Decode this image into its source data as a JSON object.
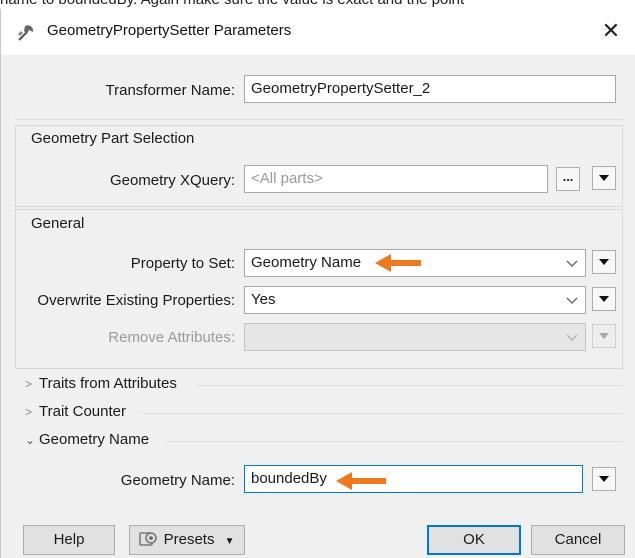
{
  "background_text": "name to boundedBy. Again make sure the value is exact and the point",
  "window": {
    "title": "GeometryPropertySetter Parameters"
  },
  "transformer": {
    "label": "Transformer Name:",
    "value": "GeometryPropertySetter_2"
  },
  "part_selection": {
    "group_title": "Geometry Part Selection",
    "xquery_label": "Geometry XQuery:",
    "xquery_placeholder": "<All parts>",
    "ellipsis_label": "..."
  },
  "general": {
    "group_title": "General",
    "property_label": "Property to Set:",
    "property_value": "Geometry Name",
    "overwrite_label": "Overwrite Existing Properties:",
    "overwrite_value": "Yes",
    "remove_label": "Remove Attributes:",
    "remove_value": ""
  },
  "sections": {
    "traits_attributes": "Traits from Attributes",
    "trait_counter": "Trait Counter",
    "geometry_name": "Geometry Name"
  },
  "geometry_name": {
    "label": "Geometry Name:",
    "value": "boundedBy"
  },
  "buttons": {
    "help": "Help",
    "presets": "Presets",
    "ok": "OK",
    "cancel": "Cancel"
  },
  "colors": {
    "annotation_arrow": "#f07a1e",
    "focus_border": "#0078d7",
    "dialog_bg": "#f0f0f0"
  },
  "icons": {
    "app": "geometry-setter-icon",
    "close": "close-icon",
    "chevron": "chevron-down-icon",
    "menu": "triangle-down-icon",
    "presets": "presets-icon"
  }
}
